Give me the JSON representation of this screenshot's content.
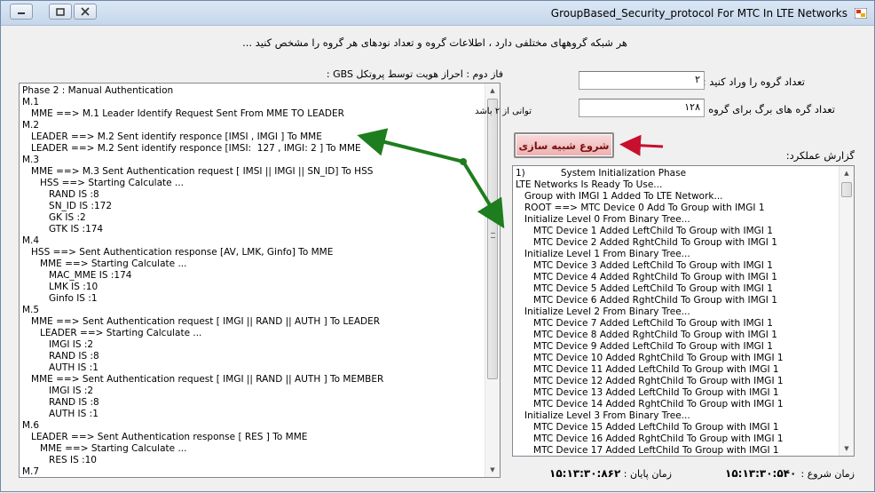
{
  "window": {
    "title": "GroupBased_Security_protocol For MTC In LTE Networks"
  },
  "header": {
    "instruction": "هر شبکه گروههای مختلفی دارد ،  اطلاعات گروه  و تعداد نودهای هر گروه را مشخص کنید ..."
  },
  "phase_panel": {
    "label": "فاز دوم : احراز هویت توسط پروتکل GBS :",
    "lines": [
      "Phase 2 : Manual Authentication",
      "M.1",
      "   MME ==> M.1 Leader Identify Request Sent From MME TO LEADER",
      "M.2",
      "   LEADER ==> M.2 Sent identify responce [IMSI , IMGI ] To MME",
      "   LEADER ==> M.2 Sent identify responce [IMSI:  127 , IMGI: 2 ] To MME",
      "M.3",
      "   MME ==> M.3 Sent Authentication request [ IMSI || IMGI || SN_ID] To HSS",
      "      HSS ==> Starting Calculate ...",
      "         RAND IS :8",
      "         SN_ID IS :172",
      "         GK IS :2",
      "         GTK IS :174",
      "M.4",
      "   HSS ==> Sent Authentication response [AV, LMK, Ginfo] To MME",
      "      MME ==> Starting Calculate ...",
      "         MAC_MME IS :174",
      "         LMK IS :10",
      "         Ginfo IS :1",
      "M.5",
      "   MME ==> Sent Authentication request [ IMGI || RAND || AUTH ] To LEADER",
      "      LEADER ==> Starting Calculate ...",
      "         IMGI IS :2",
      "         RAND IS :8",
      "         AUTH IS :1",
      "   MME ==> Sent Authentication request [ IMGI || RAND || AUTH ] To MEMBER",
      "         IMGI IS :2",
      "         RAND IS :8",
      "         AUTH IS :1",
      "M.6",
      "   LEADER ==> Sent Authentication response [ RES ] To MME",
      "      MME ==> Starting Calculate ...",
      "         RES IS :10",
      "M.7"
    ]
  },
  "group_count": {
    "label": "تعداد گروه را وراد کنید :",
    "value": "۲"
  },
  "leaf_count": {
    "label": "تعداد گره های برگ برای گروه :",
    "value": "۱۲۸",
    "hint": "توانی از ۲ باشد"
  },
  "simulate_button": {
    "label": "شروع شبیه سازی"
  },
  "report_panel": {
    "label": "گزارش عملکرد:",
    "lines": [
      "1)            System Initialization Phase",
      "LTE Networks Is Ready To Use...",
      "   Group with IMGI 1 Added To LTE Network...",
      "   ROOT ==> MTC Device 0 Add To Group with IMGI 1",
      "   Initialize Level 0 From Binary Tree...",
      "      MTC Device 1 Added LeftChild To Group with IMGI 1",
      "      MTC Device 2 Added RghtChild To Group with IMGI 1",
      "   Initialize Level 1 From Binary Tree...",
      "      MTC Device 3 Added LeftChild To Group with IMGI 1",
      "      MTC Device 4 Added RghtChild To Group with IMGI 1",
      "      MTC Device 5 Added LeftChild To Group with IMGI 1",
      "      MTC Device 6 Added RghtChild To Group with IMGI 1",
      "   Initialize Level 2 From Binary Tree...",
      "      MTC Device 7 Added LeftChild To Group with IMGI 1",
      "      MTC Device 8 Added RghtChild To Group with IMGI 1",
      "      MTC Device 9 Added LeftChild To Group with IMGI 1",
      "      MTC Device 10 Added RghtChild To Group with IMGI 1",
      "      MTC Device 11 Added LeftChild To Group with IMGI 1",
      "      MTC Device 12 Added RghtChild To Group with IMGI 1",
      "      MTC Device 13 Added LeftChild To Group with IMGI 1",
      "      MTC Device 14 Added RghtChild To Group with IMGI 1",
      "   Initialize Level 3 From Binary Tree...",
      "      MTC Device 15 Added LeftChild To Group with IMGI 1",
      "      MTC Device 16 Added RghtChild To Group with IMGI 1",
      "      MTC Device 17 Added LeftChild To Group with IMGI 1"
    ]
  },
  "timing": {
    "start_label": "زمان شروع :",
    "start_value": "۱۵:۱۳:۳۰:۵۴۰",
    "end_label": "زمان پایان :",
    "end_value": "۱۵:۱۳:۳۰:۸۶۲"
  },
  "colors": {
    "arrow_green": "#1e7d1e",
    "arrow_red": "#c8102e",
    "button_text": "#7a1010"
  }
}
